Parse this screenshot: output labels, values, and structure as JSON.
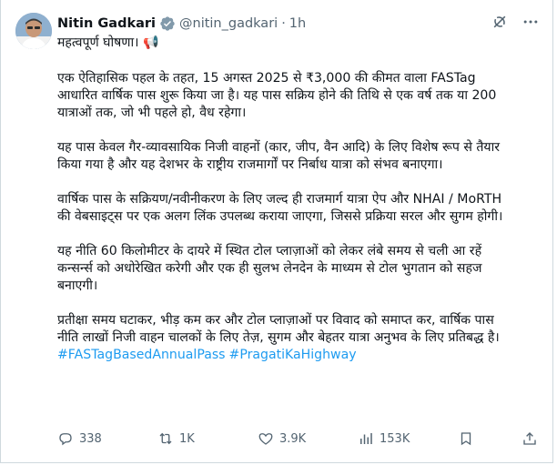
{
  "post": {
    "author_name": "Nitin Gadkari",
    "handle": "@nitin_gadkari",
    "separator": "·",
    "time": "1h",
    "headline": "महत्वपूर्ण घोषणा। 📢",
    "paragraphs": [
      "एक ऐतिहासिक पहल के तहत, 15 अगस्त 2025 से ₹3,000 की कीमत वाला FASTag आधारित वार्षिक पास शुरू किया जा है। यह पास सक्रिय होने की तिथि से एक वर्ष तक या 200 यात्राओं तक, जो भी पहले हो, वैध रहेगा।",
      "यह पास केवल गैर-व्यावसायिक निजी वाहनों (कार, जीप, वैन आदि) के लिए विशेष रूप से तैयार किया गया है और यह देशभर के राष्ट्रीय राजमार्गों पर निर्बाध यात्रा को संभव बनाएगा।",
      "वार्षिक पास के सक्रियण/नवीनीकरण के लिए जल्द ही राजमार्ग यात्रा ऐप और NHAI / MoRTH की वेबसाइट्स पर एक अलग लिंक उपलब्ध कराया जाएगा, जिससे प्रक्रिया सरल और सुगम होगी।",
      "यह नीति 60 किलोमीटर के दायरे में स्थित टोल प्लाज़ाओं को लेकर लंबे समय से चली आ रहें कन्सर्न्स को अधोरेखित करेगी और एक ही सुलभ लेनदेन के माध्यम से टोल भुगतान को सहज बनाएगी।",
      "प्रतीक्षा समय घटाकर, भीड़ कम कर और टोल प्लाज़ाओं पर विवाद को समाप्त कर, वार्षिक पास नीति लाखों निजी वाहन चालकों के लिए तेज़, सुगम और बेहतर यात्रा अनुभव के लिए प्रतिबद्ध है।"
    ],
    "hashtags": [
      "#FASTagBasedAnnualPass",
      "#PragatiKaHighway"
    ]
  },
  "actions": {
    "replies": "338",
    "reposts": "1K",
    "likes": "3.9K",
    "views": "153K"
  },
  "icons": {
    "verified": "verified-badge-icon",
    "grok": "grok-icon",
    "more": "more-icon",
    "reply": "reply-icon",
    "repost": "repost-icon",
    "like": "heart-icon",
    "views": "views-icon",
    "bookmark": "bookmark-icon",
    "share": "share-icon"
  },
  "colors": {
    "accent": "#1d9bf0",
    "muted": "#536471",
    "text": "#0f1419",
    "border": "#cfd9de"
  }
}
